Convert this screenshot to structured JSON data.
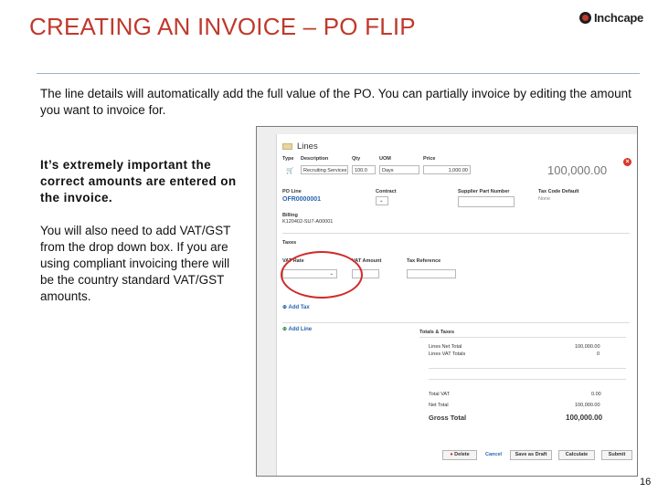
{
  "slide": {
    "title": "CREATING AN INVOICE – PO FLIP",
    "logo_text": "Inchcape",
    "intro": "The line details will automatically add the full value of the PO. You can partially invoice by editing the amount you want to invoice for.",
    "emphasis": "It’s extremely important the correct amounts are entered on the invoice.",
    "note": "You will also need to add VAT/GST from the drop down box. If you are using compliant invoicing there will be the country standard VAT/GST amounts.",
    "page_number": "16"
  },
  "screenshot": {
    "lines_title": "Lines",
    "headers": {
      "type": "Type",
      "description": "Description",
      "qty": "Qty",
      "uom": "UOM",
      "price": "Price"
    },
    "row": {
      "description": "Recruiting Services",
      "qty": "100.0",
      "uom": "Days",
      "price": "1,000.00",
      "amount": "100,000.00"
    },
    "po_line_label": "PO Line",
    "po_line_value": "OFR0000001",
    "contract_label": "Contract",
    "supplier_part_label": "Supplier Part Number",
    "tax_code_label": "Tax Code Default",
    "tax_code_value": "None",
    "billing_label": "Billing",
    "billing_value": "K120402-SU7-A00001",
    "taxes_label": "Taxes",
    "vat_rate_label": "VAT Rate",
    "vat_amount_label": "VAT Amount",
    "tax_reference_label": "Tax Reference",
    "add_tax_link": "Add Tax",
    "add_line_link": "Add Line",
    "totals_title": "Totals & Taxes",
    "lines_net_total_label": "Lines Net Total",
    "lines_net_total_value": "100,000.00",
    "lines_vat_totals_label": "Lines VAT Totals",
    "lines_vat_totals_value": "0",
    "total_vat_label": "Total VAT",
    "total_vat_value": "0.00",
    "net_total_label": "Net Total",
    "net_total_value": "100,000.00",
    "gross_total_label": "Gross Total",
    "gross_total_value": "100,000.00",
    "buttons": {
      "delete": "Delete",
      "cancel": "Cancel",
      "save_draft": "Save as Draft",
      "calculate": "Calculate",
      "submit": "Submit"
    }
  },
  "colors": {
    "title": "#c0392b",
    "highlight_circle": "#d22a2a",
    "link": "#2a63b0",
    "rule": "#9cb0c8"
  }
}
